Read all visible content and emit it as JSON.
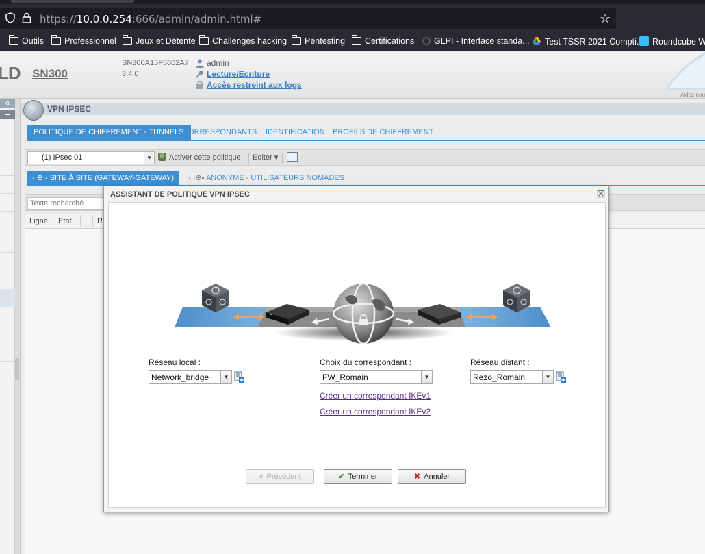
{
  "browser": {
    "url_prefix": "https://",
    "url_host": "10.0.0.254",
    "url_rest": ":666/admin/admin.html#",
    "bookmarks": [
      {
        "label": "Outils",
        "icon": "folder-icon"
      },
      {
        "label": "Professionnel",
        "icon": "folder-icon"
      },
      {
        "label": "Jeux et Détente",
        "icon": "folder-icon"
      },
      {
        "label": "Challenges hacking",
        "icon": "folder-icon"
      },
      {
        "label": "Pentesting",
        "icon": "folder-icon"
      },
      {
        "label": "Certifications",
        "icon": "folder-icon"
      },
      {
        "label": "GLPI - Interface standa...",
        "icon": "glpi-icon"
      },
      {
        "label": "Test TSSR 2021 Compti...",
        "icon": "google-drive-icon"
      },
      {
        "label": "Roundcube W",
        "icon": "roundcube-icon"
      }
    ]
  },
  "header": {
    "logo_fragment": "LD",
    "model": "SN300",
    "serial": "SN300A15F5802A7",
    "version": "3.4.0",
    "user": "admin",
    "rw_link": "Lecture/Ecriture",
    "logs_link": "Accès restreint aux logs",
    "help_text": "Aidez-nou"
  },
  "module": {
    "title": "VPN IPSEC",
    "tabs": [
      "POLITIQUE DE CHIFFREMENT - TUNNELS",
      "CORRESPONDANTS",
      "IDENTIFICATION",
      "PROFILS DE CHIFFREMENT"
    ],
    "policy_selected": "(1) IPsec 01",
    "activate_policy": "Activer cette politique",
    "edit_menu": "Editer",
    "subtabs": [
      "SITE À SITE (GATEWAY-GATEWAY)",
      "ANONYME - UTILISATEURS NOMADES"
    ],
    "search_placeholder": "Texte recherché",
    "grid_columns": [
      "Ligne",
      "Etat",
      "R"
    ]
  },
  "modal": {
    "title": "ASSISTANT DE POLITIQUE VPN IPSEC",
    "local_label": "Réseau local :",
    "local_value": "Network_bridge",
    "peer_label": "Choix du correspondant :",
    "peer_value": "FW_Romain",
    "remote_label": "Réseau distant :",
    "remote_value": "Rezo_Romain",
    "link_ikev1": "Créer un correspondant IKEv1",
    "link_ikev2": "Créer un correspondant IKEv2",
    "btn_previous": "Précédent",
    "btn_finish": "Terminer",
    "btn_cancel": "Annuler"
  },
  "colors": {
    "accent": "#3d8fd1",
    "link": "#3a7ec2",
    "visited_link": "#5a2d8c",
    "cancel_icon": "#c62828",
    "finish_icon": "#3f9b2e"
  }
}
